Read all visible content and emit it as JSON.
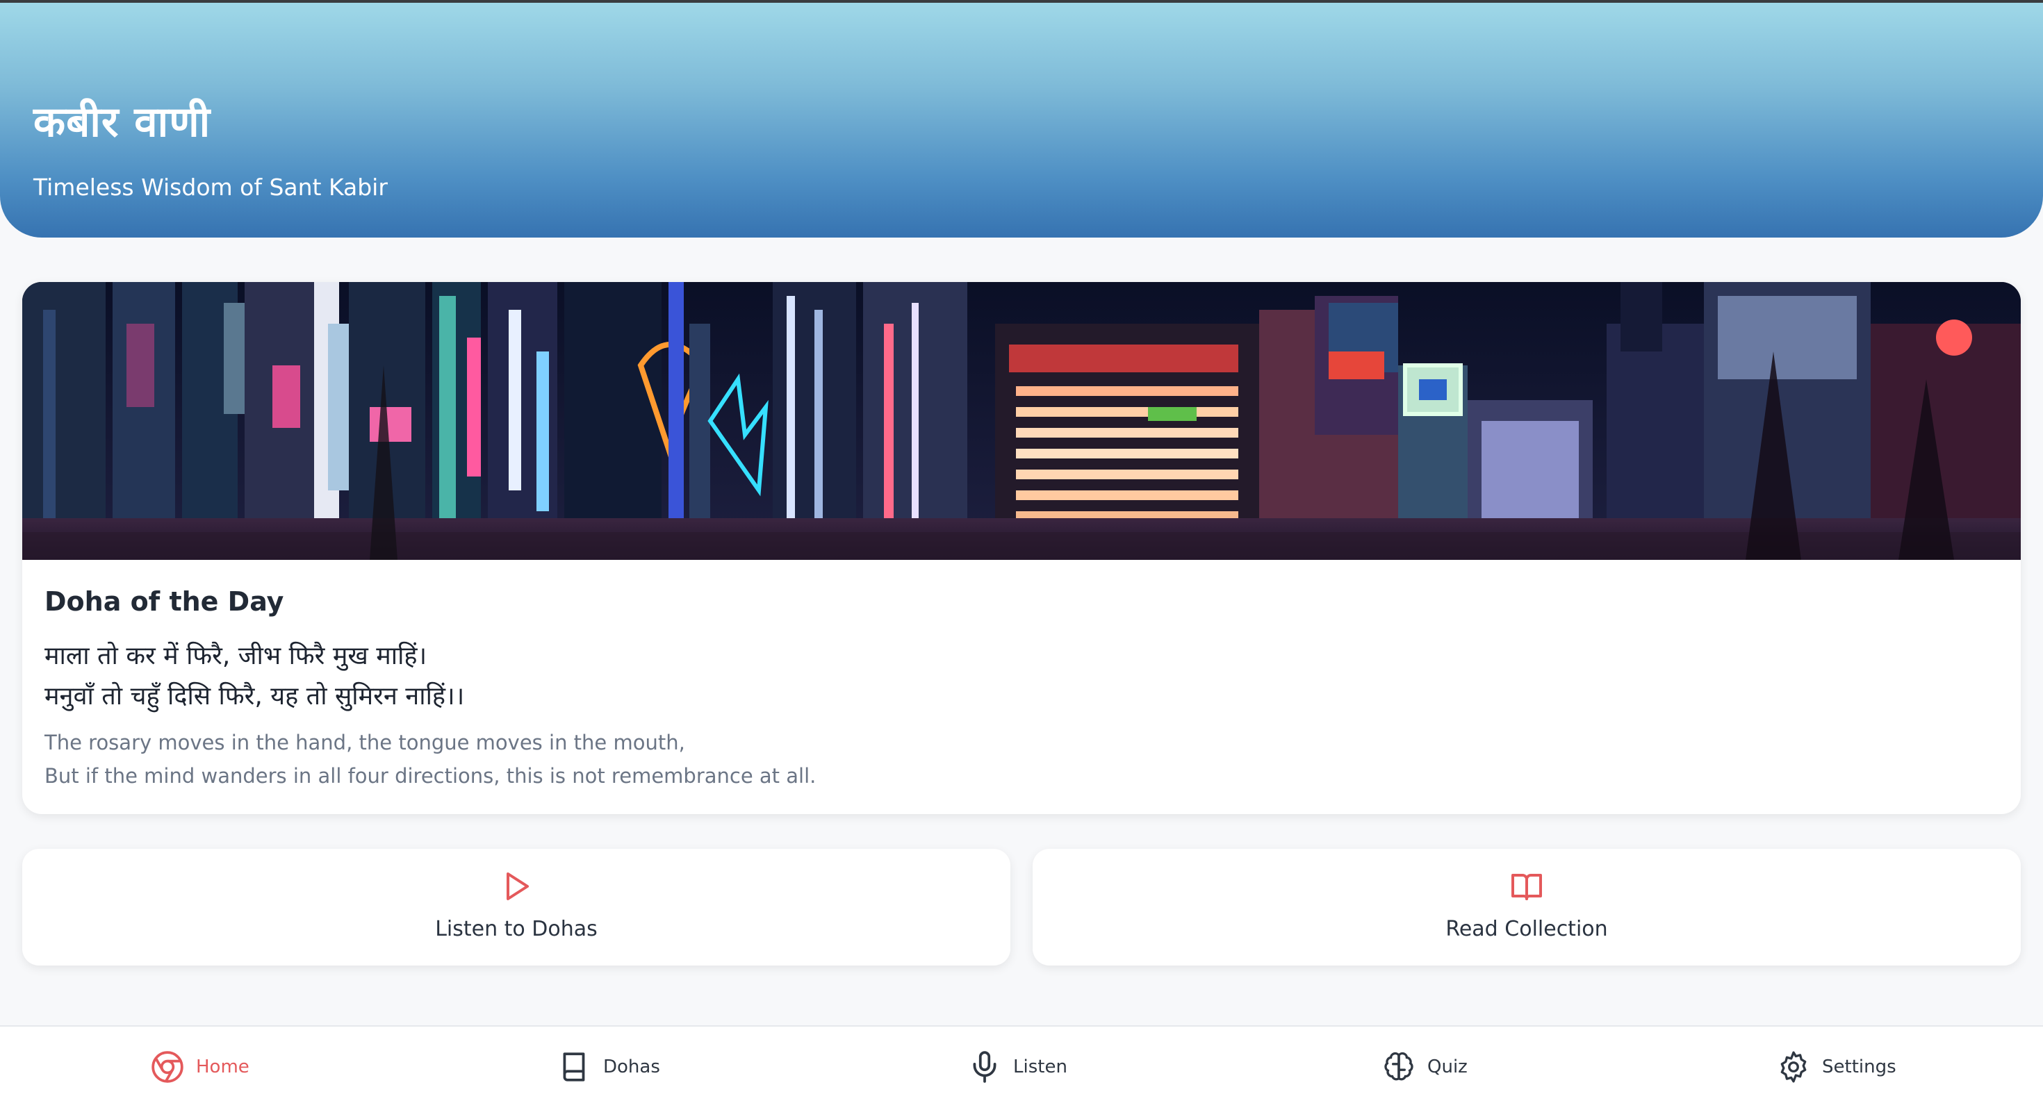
{
  "header": {
    "title": "कबीर वाणी",
    "subtitle": "Timeless Wisdom of Sant Kabir"
  },
  "doha_card": {
    "heading": "Doha of the Day",
    "hindi_lines": [
      "माला तो कर में फिरै, जीभ फिरै मुख माहिं।",
      "मनुवाँ तो चहुँ दिसि फिरै, यह तो सुमिरन नाहिं।।"
    ],
    "english_lines": [
      "The rosary moves in the hand, the tongue moves in the mouth,",
      "But if the mind wanders in all four directions, this is not remembrance at all."
    ]
  },
  "actions": [
    {
      "label": "Listen to Dohas",
      "icon": "play-icon"
    },
    {
      "label": "Read Collection",
      "icon": "book-open-icon"
    }
  ],
  "bottom_nav": {
    "items": [
      {
        "label": "Home",
        "icon": "chrome-icon",
        "active": true
      },
      {
        "label": "Dohas",
        "icon": "book-icon",
        "active": false
      },
      {
        "label": "Listen",
        "icon": "microphone-icon",
        "active": false
      },
      {
        "label": "Quiz",
        "icon": "brain-icon",
        "active": false
      },
      {
        "label": "Settings",
        "icon": "gear-icon",
        "active": false
      }
    ]
  },
  "colors": {
    "accent": "#e4595b",
    "header_top": "#9fd8e8",
    "header_bottom": "#3673b1",
    "text_dark": "#222a36",
    "text_muted": "#6b7585"
  }
}
